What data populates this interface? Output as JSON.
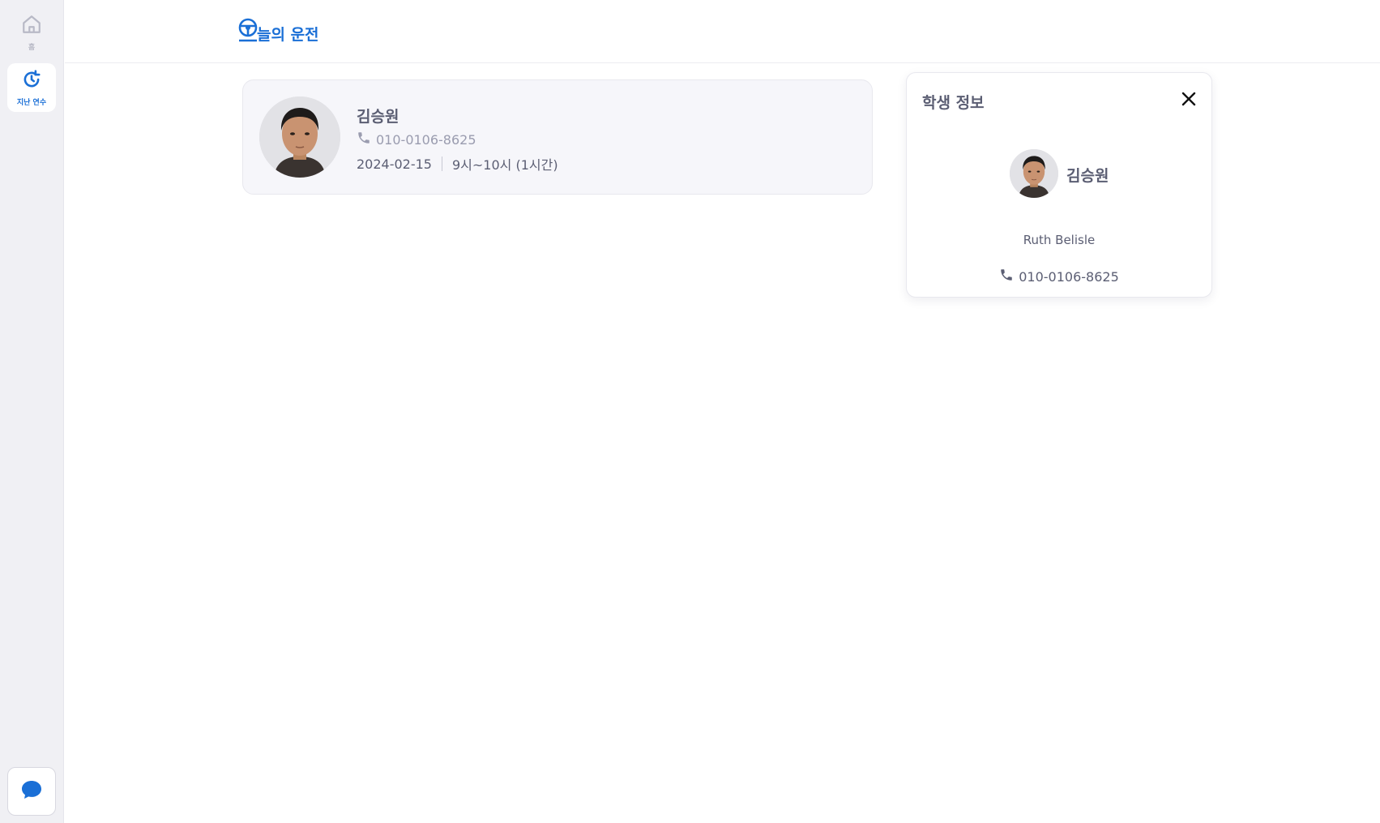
{
  "sidebar": {
    "items": [
      {
        "label": "홈",
        "icon": "home-icon"
      },
      {
        "label": "지난 연수",
        "icon": "history-icon"
      }
    ],
    "chat_icon": "chat-bubble-icon"
  },
  "header": {
    "logo_text": "늘의 운전",
    "logo_icon": "steering-wheel-icon"
  },
  "lesson_card": {
    "name": "김승원",
    "phone": "010-0106-8625",
    "date": "2024-02-15",
    "time": "9시~10시 (1시간)"
  },
  "student_panel": {
    "title": "학생 정보",
    "name": "김승원",
    "guardian": "Ruth Belisle",
    "phone": "010-0106-8625"
  },
  "colors": {
    "accent": "#1a6fd6",
    "sidebar_bg": "#f0f0f4",
    "card_bg": "#f6f6fa",
    "text": "#5b5e73",
    "muted": "#9a9caf"
  }
}
